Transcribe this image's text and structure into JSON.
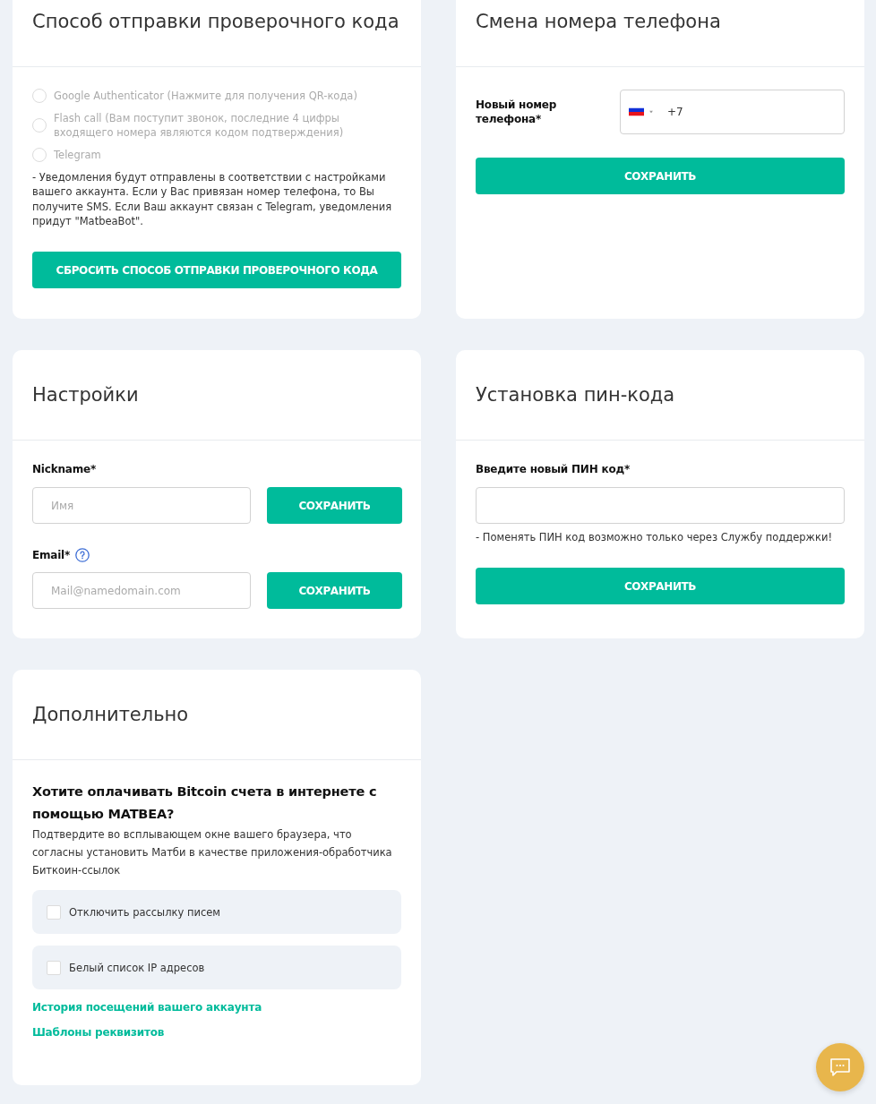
{
  "verification_method": {
    "title": "Способ отправки проверочного кода",
    "options": [
      {
        "label": "Google Authenticator (Нажмите для получения QR-кода)",
        "selected": false,
        "disabled": true
      },
      {
        "label": "Flash call (Вам поступит звонок, последние 4 цифры входящего номера являются кодом подтверждения)",
        "selected": false,
        "disabled": true
      },
      {
        "label": "Telegram",
        "selected": false,
        "disabled": true
      }
    ],
    "note": "- Уведомления будут отправлены в соответствии с настройками вашего аккаунта. Если у Вас привязан номер телефона, то Вы получите SMS. Если Ваш аккаунт связан с Telegram, уведомления придут \"MatbeaBot\".",
    "button": "СБРОСИТЬ СПОСОБ ОТПРАВКИ ПРОВЕРОЧНОГО КОДА"
  },
  "phone_change": {
    "title": "Смена номера телефона",
    "label": "Новый номер телефона*",
    "value": "+7",
    "button": "СОХРАНИТЬ"
  },
  "settings": {
    "title": "Настройки",
    "fields": [
      {
        "label": "Nickname*",
        "placeholder": "Имя",
        "help": false,
        "button": "СОХРАНИТЬ"
      },
      {
        "label": "Email*",
        "placeholder": "Mail@namedomain.com",
        "help": true,
        "button": "СОХРАНИТЬ"
      }
    ]
  },
  "pin": {
    "title": "Установка пин-кода",
    "label": "Введите новый ПИН код*",
    "note": "- Поменять ПИН код возможно только через Службу поддержки!",
    "button": "СОХРАНИТЬ"
  },
  "additional": {
    "title": "Дополнительно",
    "question": "Хотите оплачивать Bitcoin счета в интернете с помощью MATBEA?",
    "description": "Подтвердите во всплывающем окне вашего браузера, что согласны установить Матби в качестве приложения-обработчика Биткоин-ссылок",
    "options": [
      {
        "label": "Отключить рассылку писем",
        "checked": false
      },
      {
        "label": "Белый список IP адресов",
        "checked": false
      }
    ],
    "links": [
      "История посещений вашего аккаунта",
      "Шаблоны реквизитов"
    ]
  }
}
